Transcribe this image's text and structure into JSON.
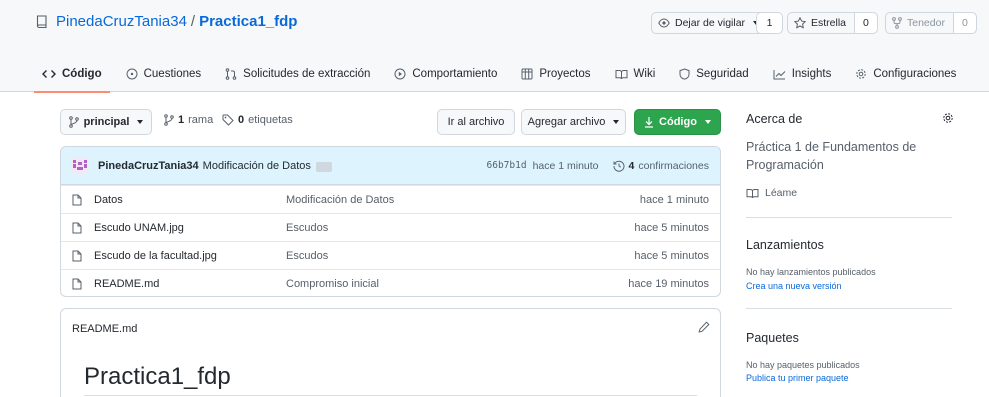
{
  "repo": {
    "owner": "PinedaCruzTania34",
    "separator": "/",
    "name": "Practica1_fdp"
  },
  "header_buttons": {
    "watch": {
      "label": "Dejar de vigilar",
      "count": "1"
    },
    "star": {
      "label": "Estrella",
      "count": "0"
    },
    "fork": {
      "label": "Tenedor",
      "count": "0"
    }
  },
  "tabs": [
    {
      "label": "Código",
      "icon": "code-icon",
      "active": true
    },
    {
      "label": "Cuestiones",
      "icon": "issue-icon"
    },
    {
      "label": "Solicitudes de extracción",
      "icon": "pull-request-icon"
    },
    {
      "label": "Comportamiento",
      "icon": "play-icon"
    },
    {
      "label": "Proyectos",
      "icon": "table-icon"
    },
    {
      "label": "Wiki",
      "icon": "book-icon"
    },
    {
      "label": "Seguridad",
      "icon": "shield-icon"
    },
    {
      "label": "Insights",
      "icon": "graph-icon"
    },
    {
      "label": "Configuraciones",
      "icon": "gear-icon"
    }
  ],
  "branch_bar": {
    "branch": "principal",
    "branches_count": "1",
    "branches_label": "rama",
    "tags_count": "0",
    "tags_label": "etiquetas",
    "goto_file": "Ir al archivo",
    "add_file": "Agregar archivo",
    "code": "Código"
  },
  "commit": {
    "author": "PinedaCruzTania34",
    "message": "Modificación de Datos",
    "sha": "66b7b1d",
    "time": "hace 1 minuto",
    "count": "4",
    "count_label": "confirmaciones"
  },
  "files": [
    {
      "name": "Datos",
      "message": "Modificación de Datos",
      "time": "hace 1 minuto"
    },
    {
      "name": "Escudo UNAM.jpg",
      "message": "Escudos",
      "time": "hace 5 minutos"
    },
    {
      "name": "Escudo de la facultad.jpg",
      "message": "Escudos",
      "time": "hace 5 minutos"
    },
    {
      "name": "README.md",
      "message": "Compromiso inicial",
      "time": "hace 19 minutos"
    }
  ],
  "readme": {
    "filename": "README.md",
    "heading": "Practica1_fdp"
  },
  "sidebar": {
    "about_title": "Acerca de",
    "description": "Práctica 1 de Fundamentos de Programación",
    "readme_link": "Léame",
    "releases_title": "Lanzamientos",
    "releases_empty": "No hay lanzamientos publicados",
    "releases_create": "Crea una nueva versión",
    "packages_title": "Paquetes",
    "packages_empty": "No hay paquetes publicados",
    "packages_publish": "Publica tu primer paquete"
  },
  "colors": {
    "link": "#0969da",
    "primary_button": "#2da44e",
    "active_tab_underline": "#fd8c73",
    "commit_bar": "#ddf4ff"
  }
}
